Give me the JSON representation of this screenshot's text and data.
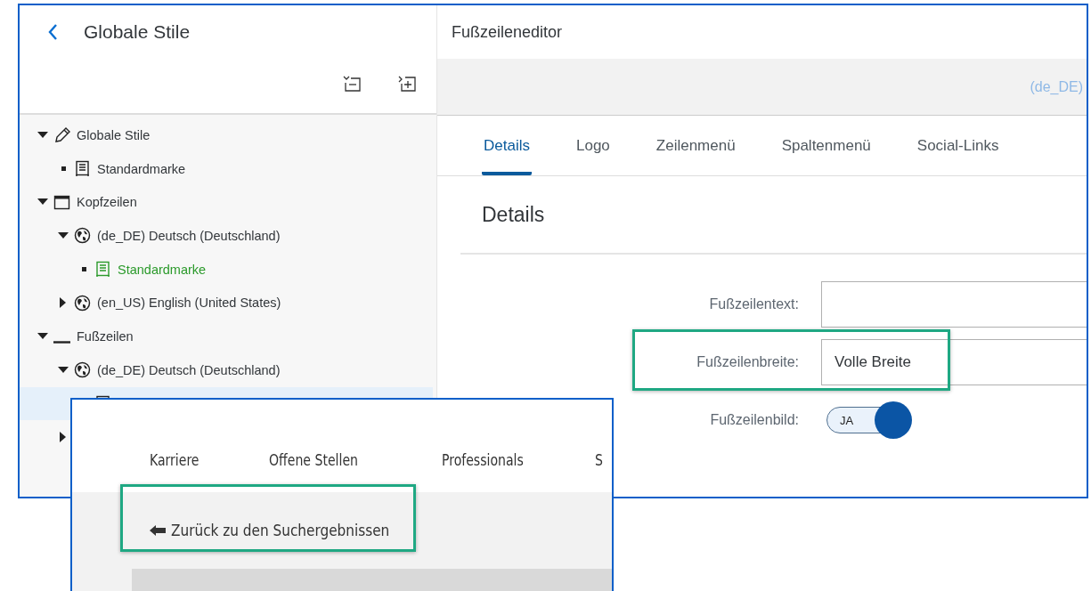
{
  "main_window": {
    "sidebar": {
      "title": "Globale Stile",
      "tree": [
        {
          "label": "Globale Stile",
          "kind": "pencil",
          "expanded": true,
          "selected": false,
          "current": false,
          "children": [
            {
              "label": "Standardmarke",
              "kind": "brand",
              "selected": false,
              "current": false
            }
          ]
        },
        {
          "label": "Kopfzeilen",
          "kind": "header",
          "expanded": true,
          "selected": false,
          "current": false,
          "children": [
            {
              "label": "(de_DE) Deutsch (Deutschland)",
              "kind": "globe",
              "expanded": true,
              "selected": false,
              "current": false,
              "children": [
                {
                  "label": "Standardmarke",
                  "kind": "brand",
                  "selected": false,
                  "current": true
                }
              ]
            },
            {
              "label": "(en_US) English (United States)",
              "kind": "globe",
              "expanded": false,
              "selected": false,
              "current": false
            }
          ]
        },
        {
          "label": "Fußzeilen",
          "kind": "footer",
          "expanded": true,
          "selected": false,
          "current": false,
          "children": [
            {
              "label": "(de_DE) Deutsch (Deutschland)",
              "kind": "globe",
              "expanded": true,
              "selected": false,
              "current": false,
              "children": [
                {
                  "kind": "brand",
                  "selected": true,
                  "current": false
                }
              ]
            },
            {
              "expanded": false,
              "selected": false
            }
          ]
        }
      ]
    },
    "editor": {
      "title": "Fußzeileneditor",
      "locale": "(de_DE)",
      "tabs": [
        {
          "label": "Details",
          "selected": true
        },
        {
          "label": "Logo",
          "selected": false
        },
        {
          "label": "Zeilenmenü",
          "selected": false
        },
        {
          "label": "Spaltenmenü",
          "selected": false
        },
        {
          "label": "Social-Links",
          "selected": false
        }
      ],
      "section_title": "Details",
      "fields": [
        {
          "kind": "text",
          "label": "Fußzeilentext:",
          "highlighted": false
        },
        {
          "kind": "text",
          "label": "Fußzeilenbreite:",
          "value": "Volle Breite",
          "highlighted": true
        },
        {
          "kind": "toggle",
          "label": "Fußzeilenbild:",
          "on": true,
          "toggle_text": "JA",
          "highlighted": false
        }
      ]
    }
  },
  "inset_window": {
    "nav": [
      {
        "label": "Karriere"
      },
      {
        "label": "Offene Stellen"
      },
      {
        "label": "Professionals"
      },
      {
        "label": "S"
      }
    ],
    "back_link": {
      "label": "Zurück zu den Suchergebnissen",
      "highlighted": true
    }
  }
}
